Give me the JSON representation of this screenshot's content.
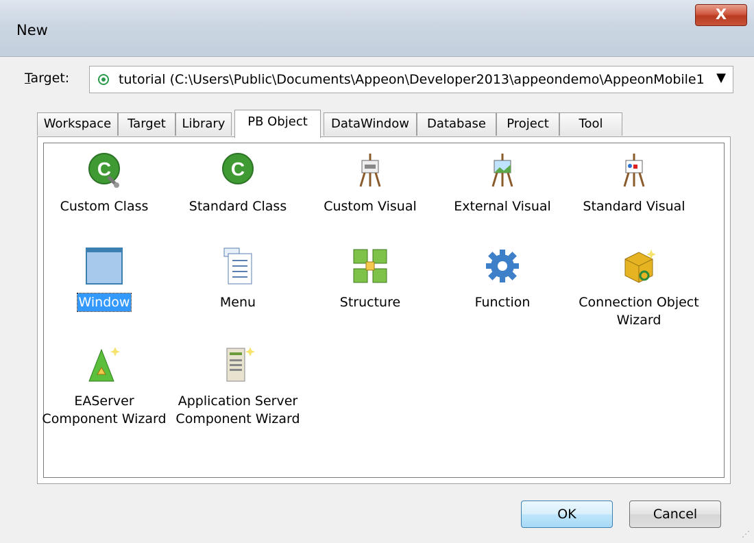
{
  "window": {
    "title": "New",
    "close_glyph": "X"
  },
  "target": {
    "label_prefix": "",
    "label_accel": "T",
    "label_rest": "arget:",
    "value": "tutorial (C:\\Users\\Public\\Documents\\Appeon\\Developer2013\\appeondemo\\AppeonMobile1"
  },
  "tabs": [
    {
      "label": "Workspace"
    },
    {
      "label": "Target"
    },
    {
      "label": "Library"
    },
    {
      "label": "PB Object"
    },
    {
      "label": "DataWindow"
    },
    {
      "label": "Database"
    },
    {
      "label": "Project"
    },
    {
      "label": "Tool"
    }
  ],
  "active_tab": "PB Object",
  "items": [
    {
      "label": "Custom Class",
      "icon": "custom-class-icon"
    },
    {
      "label": "Standard Class",
      "icon": "standard-class-icon"
    },
    {
      "label": "Custom Visual",
      "icon": "custom-visual-icon"
    },
    {
      "label": "External Visual",
      "icon": "external-visual-icon"
    },
    {
      "label": "Standard Visual",
      "icon": "standard-visual-icon"
    },
    {
      "label": "Window",
      "icon": "window-icon",
      "selected": true
    },
    {
      "label": "Menu",
      "icon": "menu-icon"
    },
    {
      "label": "Structure",
      "icon": "structure-icon"
    },
    {
      "label": "Function",
      "icon": "function-icon"
    },
    {
      "label_line1": "Connection Object",
      "label_line2": "Wizard",
      "icon": "connection-wizard-icon"
    },
    {
      "label_line1": "EAServer",
      "label_line2": "Component Wizard",
      "icon": "easerver-wizard-icon"
    },
    {
      "label_line1": "Application Server",
      "label_line2": "Component Wizard",
      "icon": "appserver-wizard-icon"
    }
  ],
  "buttons": {
    "ok": "OK",
    "cancel": "Cancel"
  },
  "colors": {
    "selection": "#3399ff",
    "close": "#c7543a",
    "radio": "#2b9a4b"
  }
}
